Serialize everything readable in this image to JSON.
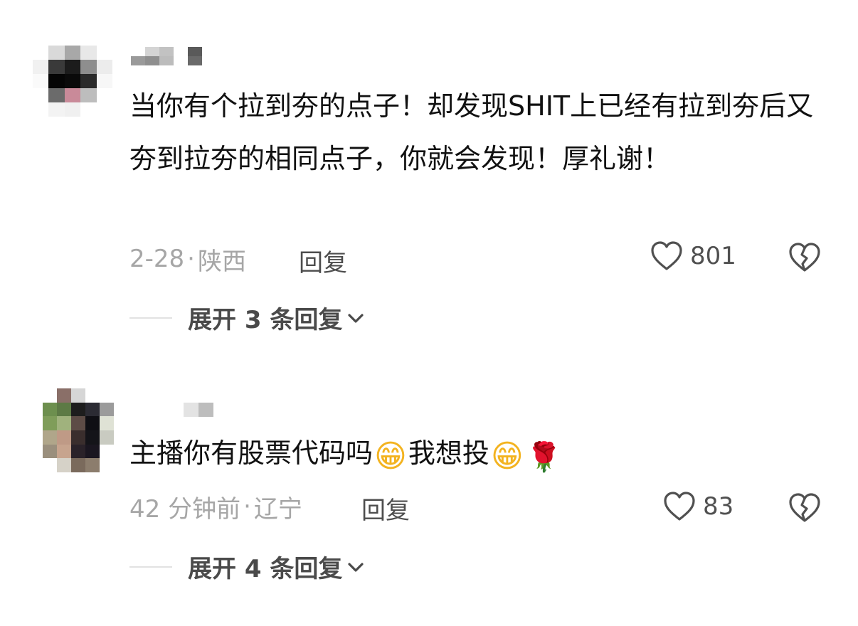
{
  "comments": [
    {
      "text": "当你有个拉到夯的点子！却发现SHIT上已经有拉到夯后又夯到拉夯的相同点子，你就会发现！厚礼谢！",
      "date": "2-28",
      "location": "陕西",
      "reply_label": "回复",
      "likes": "801",
      "expand_label": "展开 3 条回复"
    },
    {
      "text_part1": "主播你有股票代码吗",
      "emoji1": "😁",
      "text_part2": "我想投",
      "emoji2": "😁",
      "emoji3": "🌹",
      "date": "42 分钟前",
      "location": "辽宁",
      "reply_label": "回复",
      "likes": "83",
      "expand_label": "展开 4 条回复"
    }
  ],
  "separator": "·",
  "icons": {
    "like": "heart-outline-icon",
    "dislike": "broken-heart-icon",
    "expand": "chevron-down-icon"
  },
  "colors": {
    "text": "#111111",
    "meta": "#a6a6a6",
    "reply": "#4d4d4d"
  }
}
